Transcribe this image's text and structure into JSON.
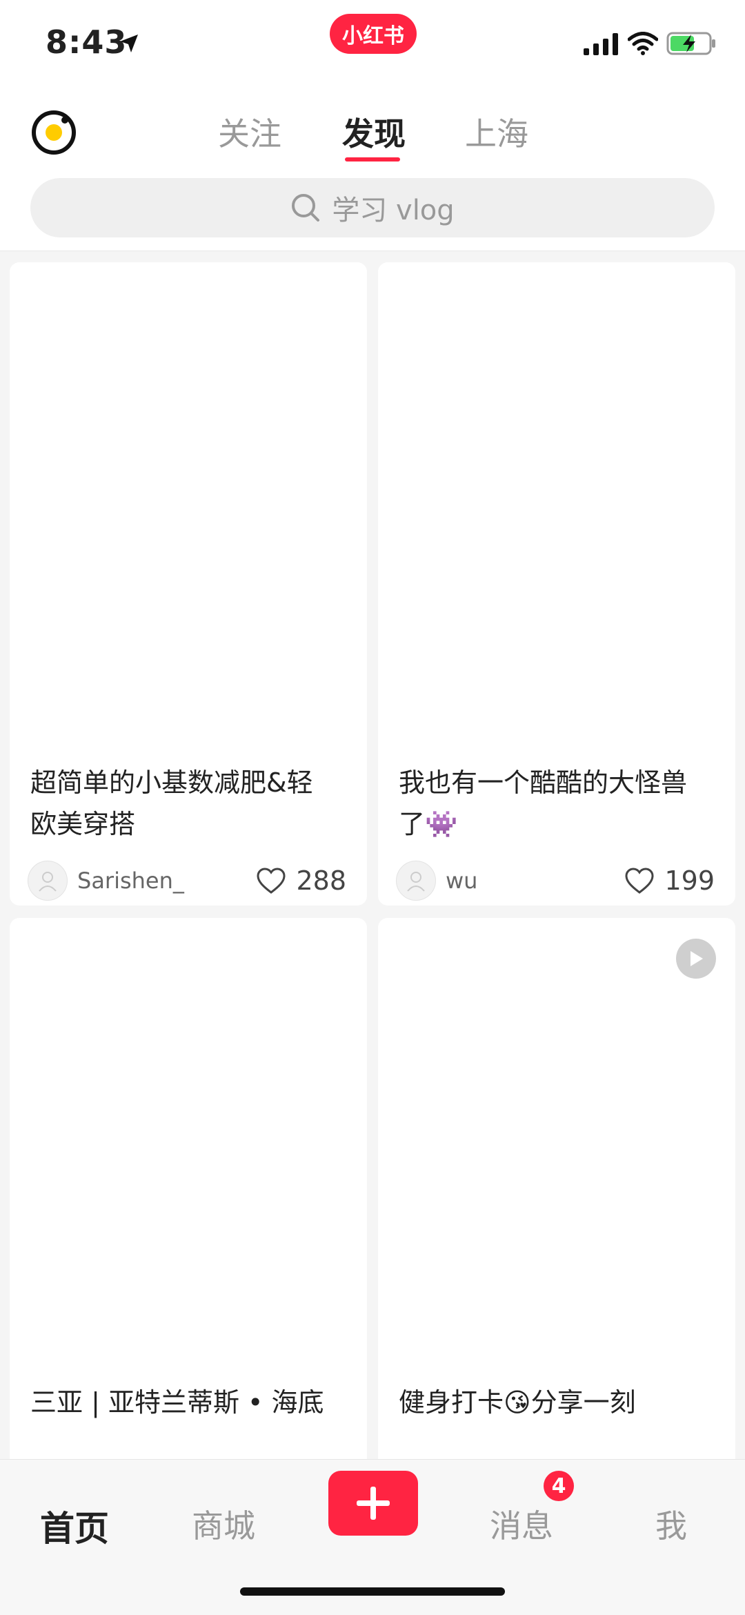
{
  "status_bar": {
    "time": "8:43",
    "app_badge": "小红书",
    "icons": [
      "location-arrow-icon",
      "signal-icon",
      "wifi-icon",
      "battery-charging-icon"
    ]
  },
  "header": {
    "tabs": [
      {
        "label": "关注"
      },
      {
        "label": "发现"
      },
      {
        "label": "上海"
      }
    ],
    "search_placeholder": "学习 vlog"
  },
  "feed": {
    "cards": [
      {
        "title_line1": "超简单的小基数减肥&轻",
        "title_line2": "欧美穿搭",
        "author": "Sarishen_",
        "likes": "288"
      },
      {
        "title_line1": "我也有一个酷酷的大怪兽",
        "title_line2": "了👾",
        "author": "wu",
        "likes": "199"
      },
      {
        "title_line1": "三亚 | 亚特兰蒂斯 • 海底"
      },
      {
        "title_line1": "健身打卡😘分享一刻"
      }
    ]
  },
  "bottom_nav": {
    "items": [
      {
        "label": "首页"
      },
      {
        "label": "商城"
      },
      {
        "label": "消息"
      },
      {
        "label": "我"
      }
    ],
    "message_badge": "4"
  },
  "colors": {
    "accent": "#ff2442",
    "text_primary": "#222222",
    "text_secondary": "#999999",
    "background": "#f5f5f5"
  }
}
